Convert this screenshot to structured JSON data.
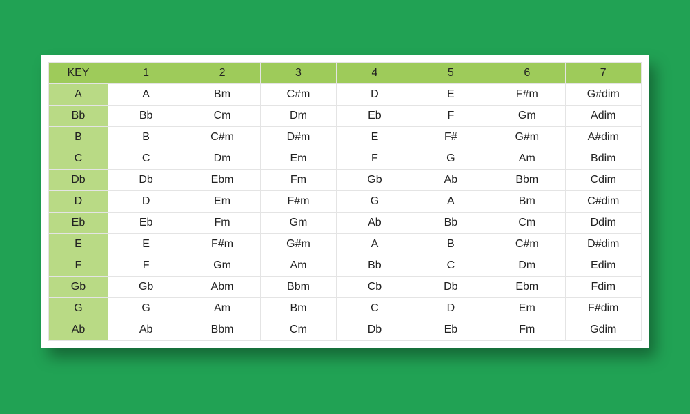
{
  "chart_data": {
    "type": "table",
    "title": "",
    "columns": [
      "KEY",
      "1",
      "2",
      "3",
      "4",
      "5",
      "6",
      "7"
    ],
    "rows": [
      {
        "key": "A",
        "values": [
          "A",
          "Bm",
          "C#m",
          "D",
          "E",
          "F#m",
          "G#dim"
        ]
      },
      {
        "key": "Bb",
        "values": [
          "Bb",
          "Cm",
          "Dm",
          "Eb",
          "F",
          "Gm",
          "Adim"
        ]
      },
      {
        "key": "B",
        "values": [
          "B",
          "C#m",
          "D#m",
          "E",
          "F#",
          "G#m",
          "A#dim"
        ]
      },
      {
        "key": "C",
        "values": [
          "C",
          "Dm",
          "Em",
          "F",
          "G",
          "Am",
          "Bdim"
        ]
      },
      {
        "key": "Db",
        "values": [
          "Db",
          "Ebm",
          "Fm",
          "Gb",
          "Ab",
          "Bbm",
          "Cdim"
        ]
      },
      {
        "key": "D",
        "values": [
          "D",
          "Em",
          "F#m",
          "G",
          "A",
          "Bm",
          "C#dim"
        ]
      },
      {
        "key": "Eb",
        "values": [
          "Eb",
          "Fm",
          "Gm",
          "Ab",
          "Bb",
          "Cm",
          "Ddim"
        ]
      },
      {
        "key": "E",
        "values": [
          "E",
          "F#m",
          "G#m",
          "A",
          "B",
          "C#m",
          "D#dim"
        ]
      },
      {
        "key": "F",
        "values": [
          "F",
          "Gm",
          "Am",
          "Bb",
          "C",
          "Dm",
          "Edim"
        ]
      },
      {
        "key": "Gb",
        "values": [
          "Gb",
          "Abm",
          "Bbm",
          "Cb",
          "Db",
          "Ebm",
          "Fdim"
        ]
      },
      {
        "key": "G",
        "values": [
          "G",
          "Am",
          "Bm",
          "C",
          "D",
          "Em",
          "F#dim"
        ]
      },
      {
        "key": "Ab",
        "values": [
          "Ab",
          "Bbm",
          "Cm",
          "Db",
          "Eb",
          "Fm",
          "Gdim"
        ]
      }
    ]
  },
  "colors": {
    "page_bg": "#21A254",
    "header_bg": "#9ECB5A",
    "row_key_bg": "#B9DA85"
  }
}
